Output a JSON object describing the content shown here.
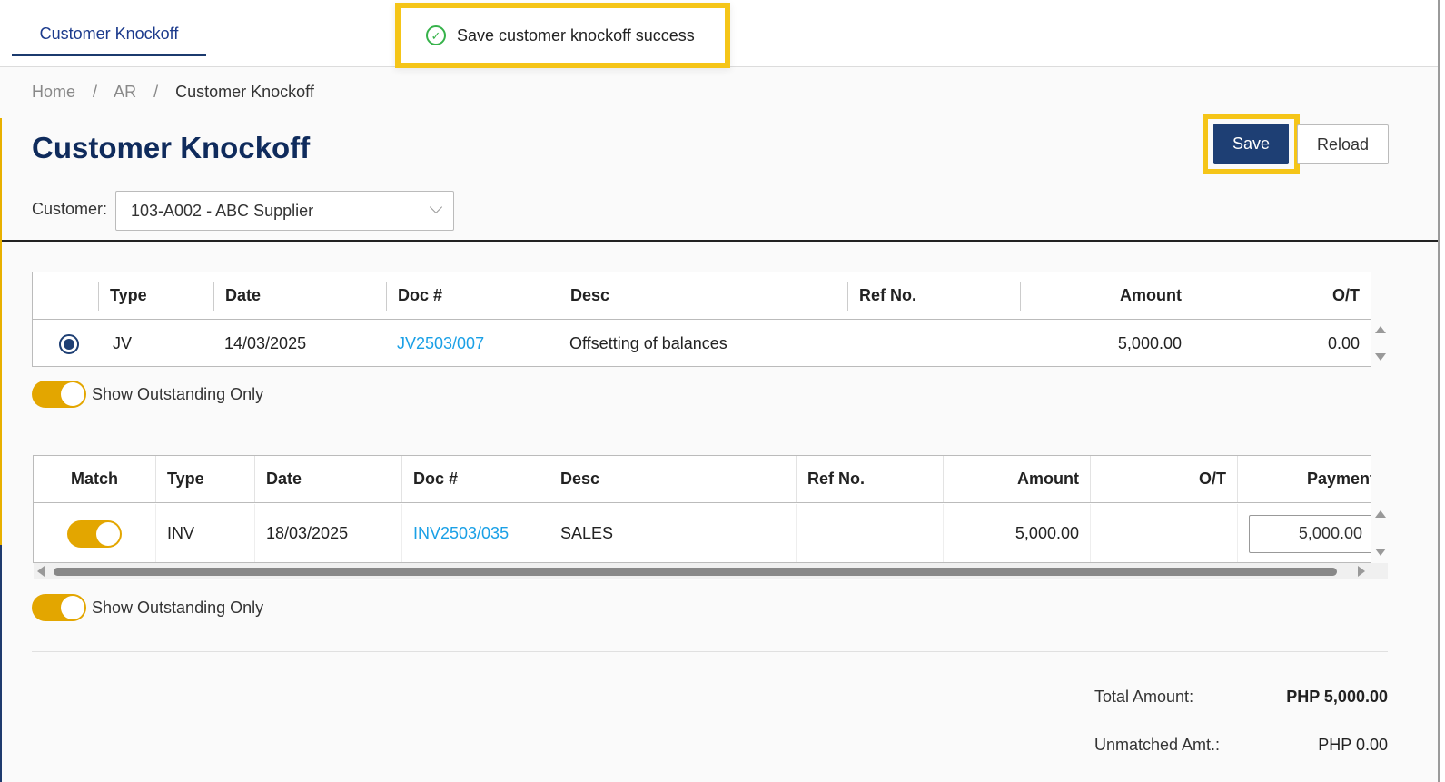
{
  "tab": {
    "label": "Customer Knockoff"
  },
  "toast": {
    "message": "Save customer knockoff success",
    "status_color": "#36b24a"
  },
  "breadcrumb": {
    "items": [
      "Home",
      "AR",
      "Customer Knockoff"
    ],
    "separator": "/"
  },
  "page_title": "Customer Knockoff",
  "actions": {
    "save_label": "Save",
    "reload_label": "Reload"
  },
  "customer": {
    "label": "Customer:",
    "value": "103-A002 - ABC Supplier"
  },
  "top_table": {
    "columns": [
      "Type",
      "Date",
      "Doc #",
      "Desc",
      "Ref No.",
      "Amount",
      "O/T"
    ],
    "rows": [
      {
        "selected": true,
        "type": "JV",
        "date": "14/03/2025",
        "doc": "JV2503/007",
        "desc": "Offsetting of balances",
        "ref": "",
        "amount": "5,000.00",
        "ot": "0.00"
      }
    ],
    "toggle_label": "Show Outstanding Only"
  },
  "bottom_table": {
    "columns": [
      "Match",
      "Type",
      "Date",
      "Doc #",
      "Desc",
      "Ref No.",
      "Amount",
      "O/T",
      "Payment"
    ],
    "rows": [
      {
        "match": true,
        "type": "INV",
        "date": "18/03/2025",
        "doc": "INV2503/035",
        "desc": "SALES",
        "ref": "",
        "amount": "5,000.00",
        "ot": "",
        "payment": "5,000.00"
      }
    ],
    "toggle_label": "Show Outstanding Only"
  },
  "totals": {
    "total_label": "Total Amount:",
    "total_value": "PHP 5,000.00",
    "unmatched_label": "Unmatched Amt.:",
    "unmatched_value": "PHP 0.00"
  },
  "colors": {
    "primary": "#1e3f74",
    "accent": "#e3a600",
    "link": "#1aa0e6",
    "highlight": "#f5c518"
  }
}
